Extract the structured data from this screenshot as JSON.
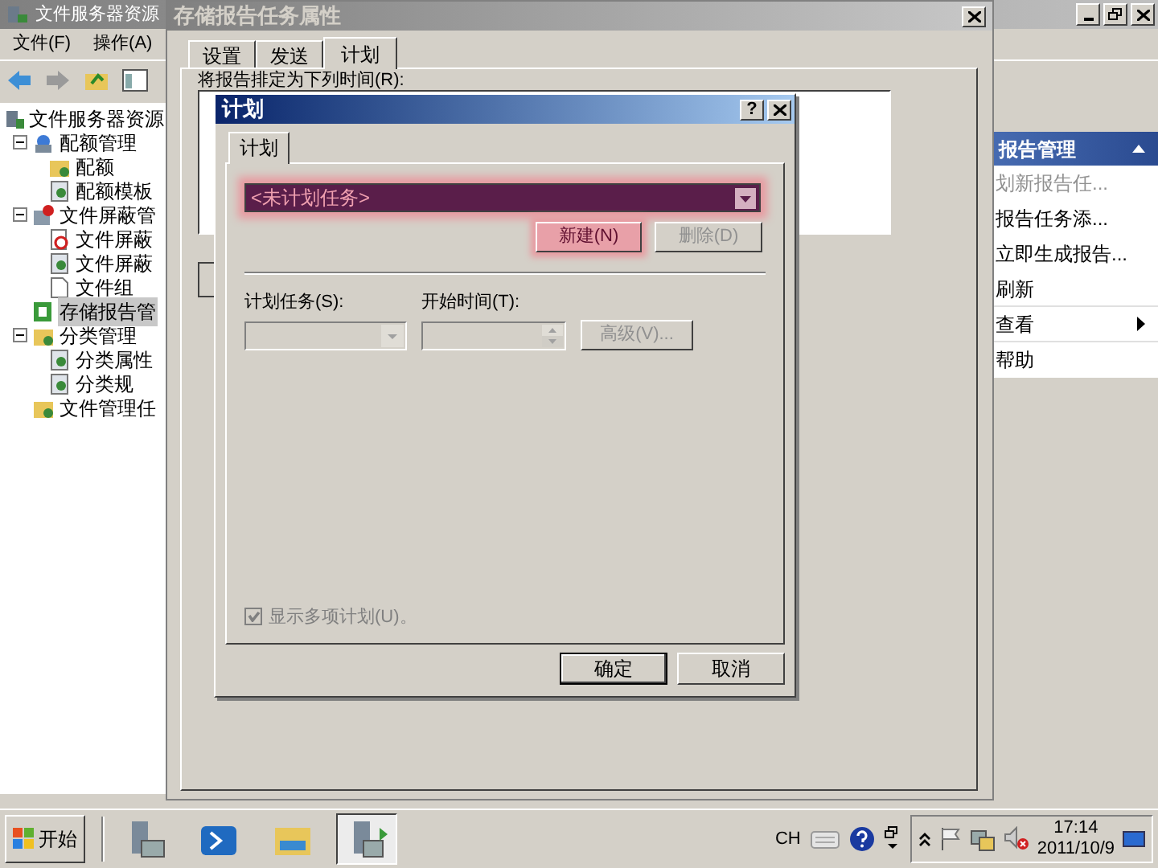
{
  "main_window": {
    "title": "文件服务器资源",
    "menu": [
      "文件(F)",
      "操作(A)"
    ],
    "tree": [
      {
        "label": "文件服务器资源",
        "selected": false,
        "children": [
          {
            "label": "配额管理",
            "selected": false,
            "expanded": true,
            "children": [
              {
                "label": "配额",
                "selected": false
              },
              {
                "label": "配额模板",
                "selected": false
              }
            ]
          },
          {
            "label": "文件屏蔽管",
            "selected": false,
            "expanded": true,
            "children": [
              {
                "label": "文件屏蔽",
                "selected": false
              },
              {
                "label": "文件屏蔽",
                "selected": false
              },
              {
                "label": "文件组",
                "selected": false
              }
            ]
          },
          {
            "label": "存储报告管",
            "selected": true
          },
          {
            "label": "分类管理",
            "selected": false,
            "expanded": true,
            "children": [
              {
                "label": "分类属性",
                "selected": false
              },
              {
                "label": "分类规",
                "selected": false
              }
            ]
          },
          {
            "label": "文件管理任",
            "selected": false
          }
        ]
      }
    ],
    "actions": {
      "header": "报告管理",
      "items": [
        {
          "label": "划新报告任...",
          "disabled": true,
          "submenu": false
        },
        {
          "label": "报告任务添...",
          "disabled": false,
          "submenu": false
        },
        {
          "label": "立即生成报告...",
          "disabled": false,
          "submenu": false
        },
        {
          "label": "刷新",
          "disabled": false,
          "submenu": false
        },
        {
          "label": "查看",
          "disabled": false,
          "submenu": true
        },
        {
          "label": "帮助",
          "disabled": false,
          "submenu": false
        }
      ]
    }
  },
  "properties_dialog": {
    "title": "存储报告任务属性",
    "tabs": [
      {
        "label": "设置",
        "selected": false
      },
      {
        "label": "发送",
        "selected": false
      },
      {
        "label": "计划",
        "selected": true
      }
    ],
    "schedule_label": "将报告排定为下列时间(R):"
  },
  "schedule_dialog": {
    "title": "计划",
    "help": "?",
    "tab": "计划",
    "task_select": {
      "value": "<未计划任务>",
      "highlighted": true
    },
    "new_button": {
      "label": "新建(N)",
      "highlighted": true
    },
    "delete_button": {
      "label": "删除(D)",
      "disabled": true
    },
    "task_label": "计划任务(S):",
    "start_label": "开始时间(T):",
    "advanced_button": {
      "label": "高级(V)...",
      "disabled": true
    },
    "multiple_checkbox": {
      "label": "显示多项计划(U)。",
      "checked": true,
      "disabled": true
    },
    "ok_button": "确定",
    "cancel_button": "取消"
  },
  "taskbar": {
    "start": "开始",
    "apps": [
      {
        "kind": "server",
        "active": false
      },
      {
        "kind": "shell",
        "active": false
      },
      {
        "kind": "explorer",
        "active": false
      },
      {
        "kind": "fsrm",
        "active": true
      }
    ],
    "language": "CH",
    "time": "17:14",
    "date": "2011/10/9"
  }
}
